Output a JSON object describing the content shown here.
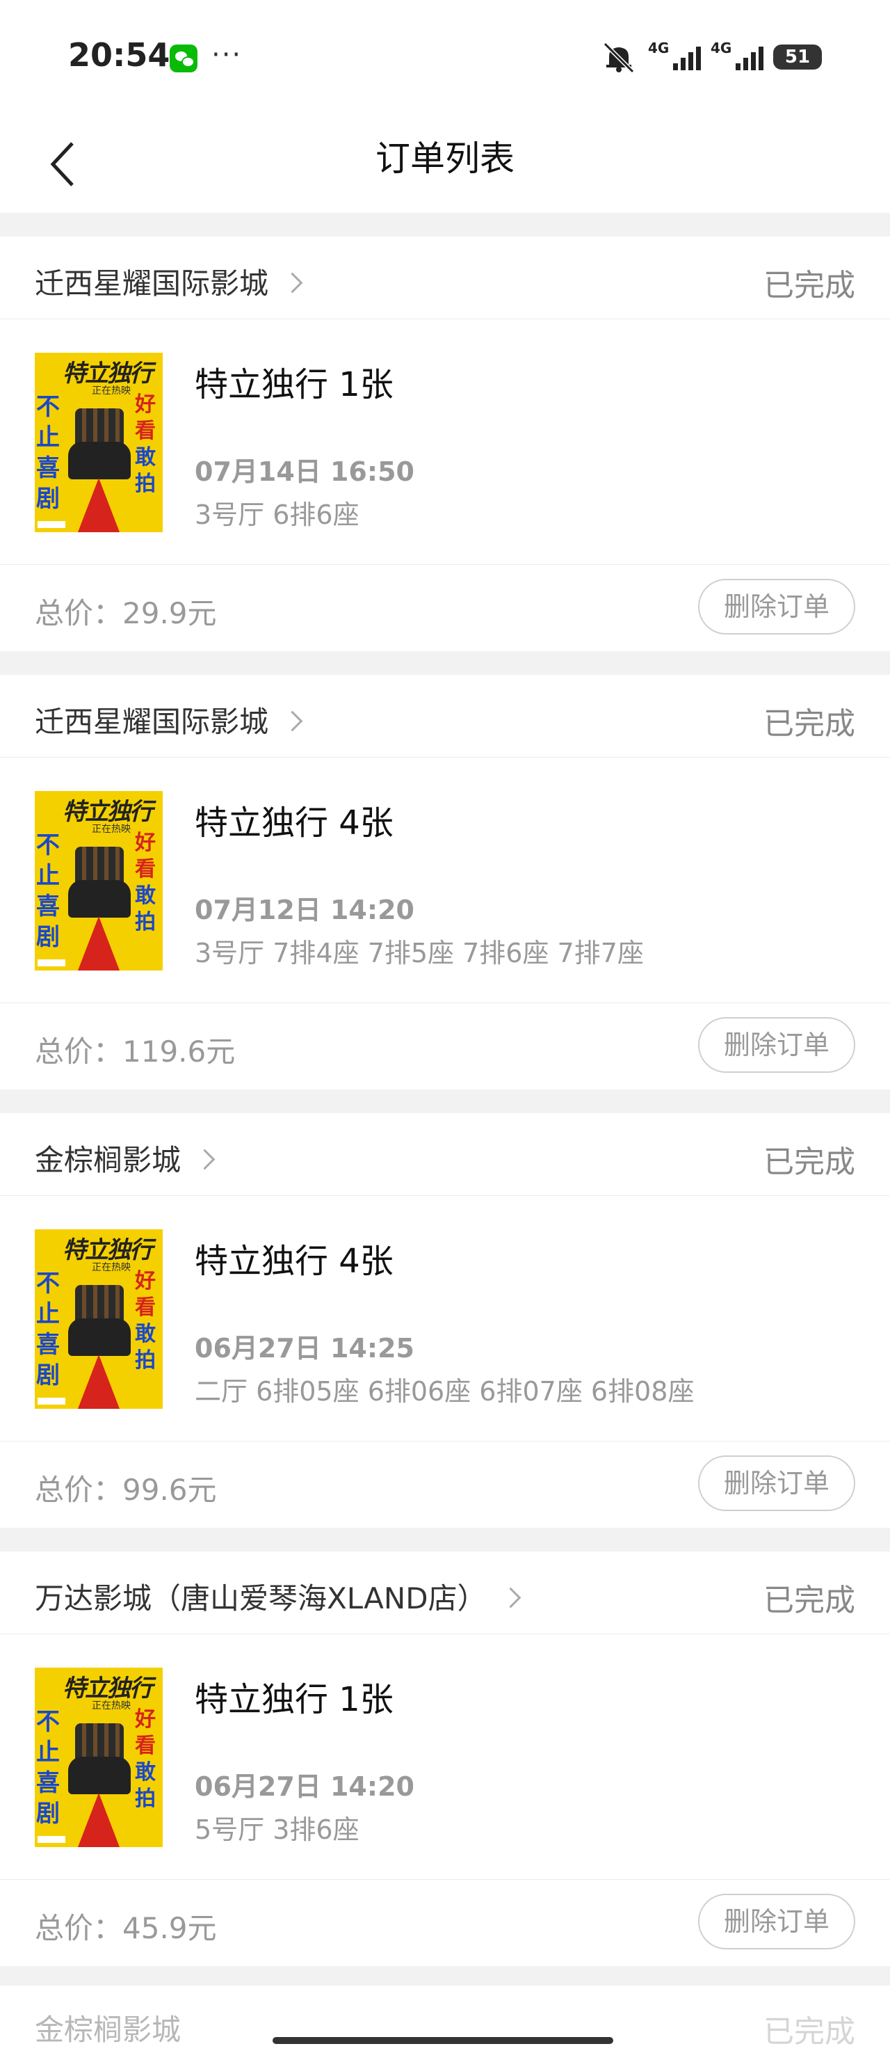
{
  "status_bar": {
    "time": "20:54",
    "more": "···",
    "net1": "4G",
    "net2": "4G",
    "battery": "51"
  },
  "nav": {
    "title": "订单列表"
  },
  "orders": [
    {
      "cinema": "迁西星耀国际影城",
      "status": "已完成",
      "movie": "特立独行 1张",
      "datetime": "07月14日 16:50",
      "seats": "3号厅 6排6座",
      "total": "总价：29.9元",
      "delete_label": "删除订单"
    },
    {
      "cinema": "迁西星耀国际影城",
      "status": "已完成",
      "movie": "特立独行 4张",
      "datetime": "07月12日 14:20",
      "seats": "3号厅 7排4座 7排5座 7排6座 7排7座",
      "total": "总价：119.6元",
      "delete_label": "删除订单"
    },
    {
      "cinema": "金棕榈影城",
      "status": "已完成",
      "movie": "特立独行 4张",
      "datetime": "06月27日 14:25",
      "seats": "二厅 6排05座 6排06座 6排07座 6排08座",
      "total": "总价：99.6元",
      "delete_label": "删除订单"
    },
    {
      "cinema": "万达影城（唐山爱琴海XLAND店）",
      "status": "已完成",
      "movie": "特立独行 1张",
      "datetime": "06月27日 14:20",
      "seats": "5号厅 3排6座",
      "total": "总价：45.9元",
      "delete_label": "删除订单"
    }
  ],
  "poster": {
    "title": "特立独行",
    "subtitle": "正在热映",
    "left_text": "不止喜剧",
    "right_text_red": "好看",
    "right_text_blue": "敢拍"
  },
  "next_order": {
    "cinema": "金棕榈影城",
    "status": "已完成"
  }
}
